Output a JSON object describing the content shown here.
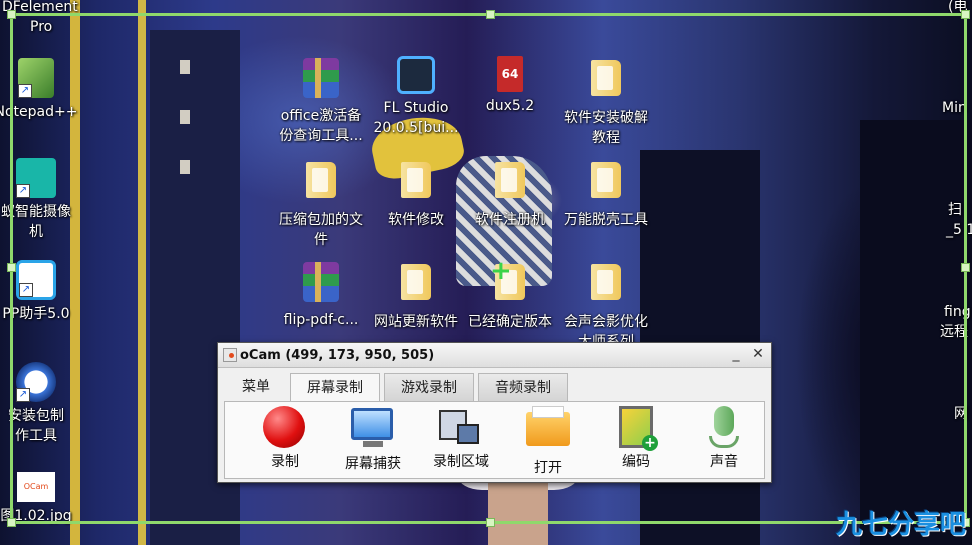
{
  "desktop": {
    "edge_labels": {
      "top_left": "DFelement",
      "top_left_2": "Pro",
      "top_right": "(电",
      "right_1": "Min",
      "right_2": "扫",
      "right_3": "_5 1",
      "right_4": "fing",
      "right_5": "远程",
      "right_6": "网"
    },
    "icons": [
      {
        "label": "Notepad++"
      },
      {
        "label": "office激活备\n份查询工具..."
      },
      {
        "label": "FL Studio\n20.0.5[bui..."
      },
      {
        "label": "dux5.2"
      },
      {
        "label": "软件安装破解\n教程"
      },
      {
        "label": "蚁智能摄像\n机"
      },
      {
        "label": "压缩包加的文\n件"
      },
      {
        "label": "软件修改"
      },
      {
        "label": "软件注册机"
      },
      {
        "label": "万能脱壳工具"
      },
      {
        "label": "PP助手5.0"
      },
      {
        "label": "flip-pdf-c..."
      },
      {
        "label": "网站更新软件"
      },
      {
        "label": "已经确定版本"
      },
      {
        "label": "会声会影优化\n大师系列"
      },
      {
        "label": "安装包制\n作工具"
      },
      {
        "label": "图1.02.jpg"
      }
    ],
    "dux_badge": "64",
    "ocam_thumb_text": "OCam"
  },
  "ocam": {
    "title": "oCam (499, 173, 950, 505)",
    "minimize_glyph": "_",
    "close_glyph": "✕",
    "tabs": [
      {
        "label": "菜单"
      },
      {
        "label": "屏幕录制"
      },
      {
        "label": "游戏录制"
      },
      {
        "label": "音频录制"
      }
    ],
    "active_tab": "屏幕录制",
    "tools": [
      {
        "label": "录制",
        "icon": "record-icon"
      },
      {
        "label": "屏幕捕获",
        "icon": "screen-capture-icon"
      },
      {
        "label": "录制区域",
        "icon": "record-area-icon"
      },
      {
        "label": "打开",
        "icon": "open-folder-icon"
      },
      {
        "label": "编码",
        "icon": "codec-icon"
      },
      {
        "label": "声音",
        "icon": "microphone-icon"
      }
    ]
  },
  "watermark": "九七分享吧",
  "colors": {
    "capture_frame": "#8fd86b",
    "watermark": "#1a8fe0"
  }
}
